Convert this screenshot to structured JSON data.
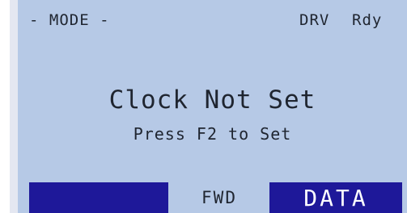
{
  "status_bar": {
    "mode_label": "- MODE -",
    "drive_label": "DRV",
    "state_label": "Rdy"
  },
  "message": {
    "title": "Clock Not Set",
    "hint": "Press F2 to Set"
  },
  "softkeys": [
    {
      "label": ""
    },
    {
      "label": "FWD"
    },
    {
      "label": "DATA"
    }
  ],
  "colors": {
    "screen_background": "#b6c9e6",
    "text": "#1f2530",
    "softkey_highlight": "#1e1899"
  }
}
